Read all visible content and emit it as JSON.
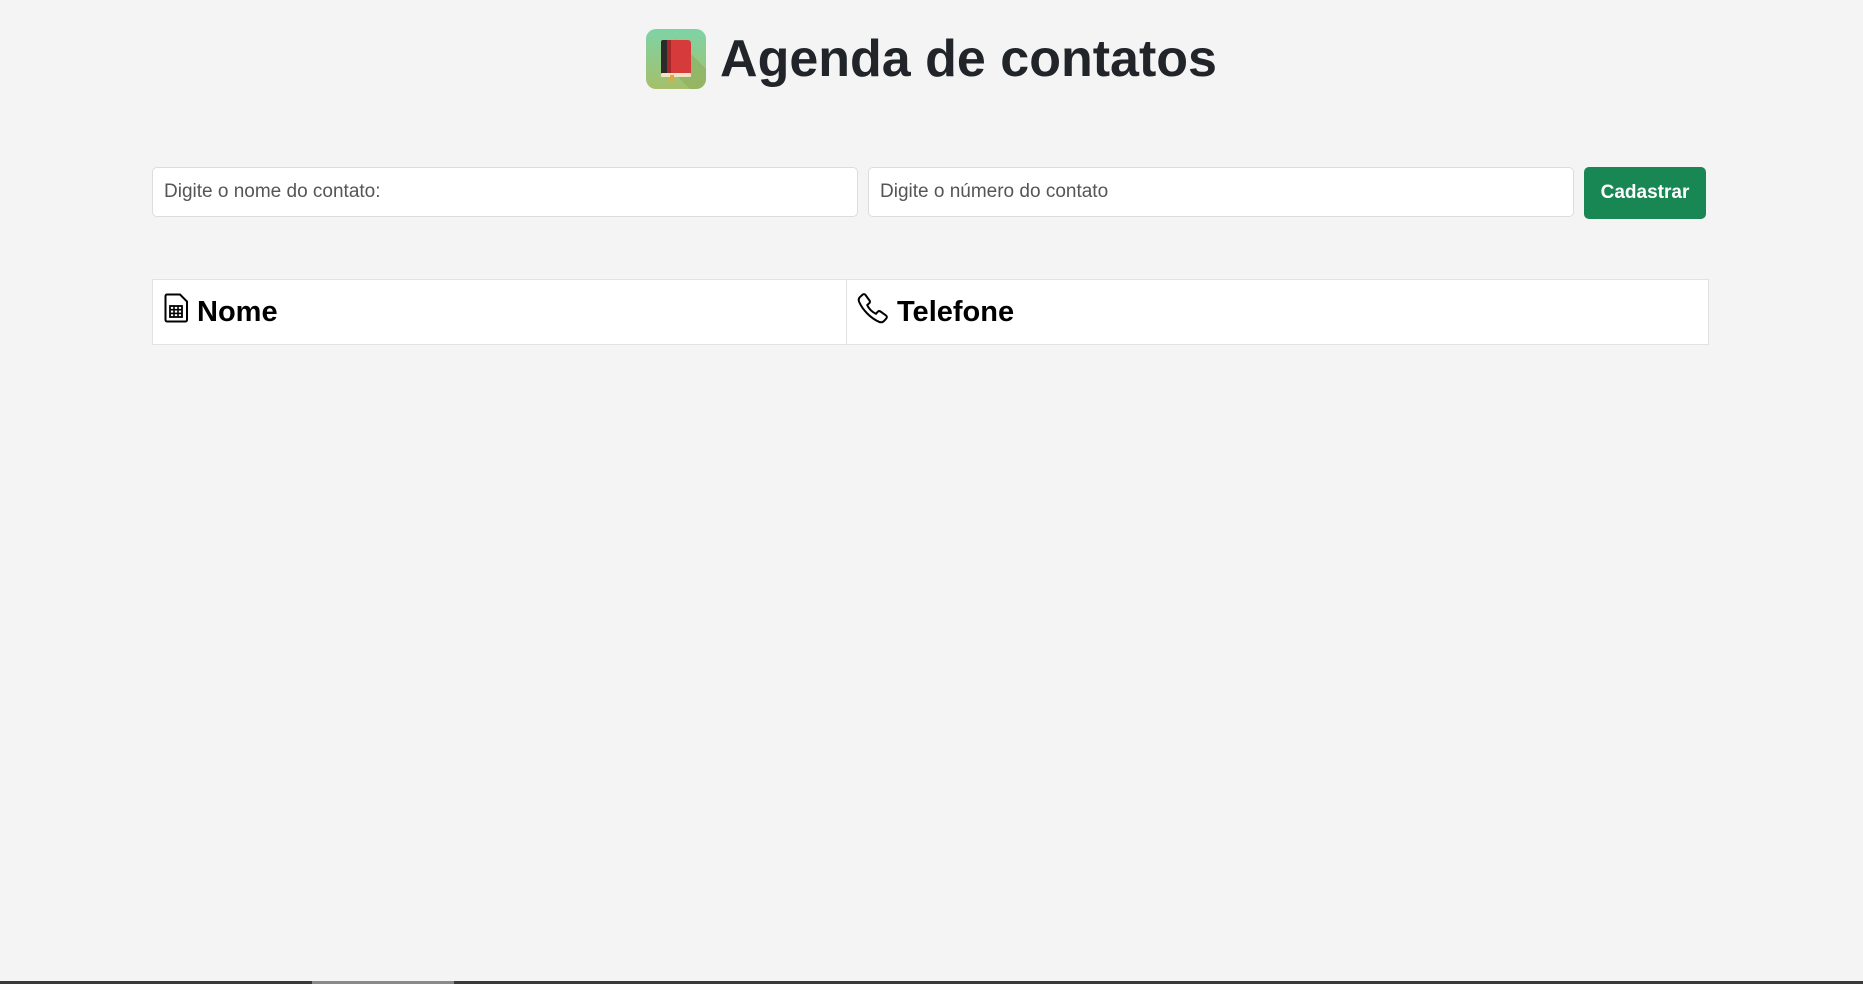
{
  "app": {
    "title": "Agenda de contatos",
    "icon": "address-book-icon"
  },
  "form": {
    "name_placeholder": "Digite o nome do contato:",
    "name_value": "",
    "number_placeholder": "Digite o número do contato",
    "number_value": "",
    "submit_label": "Cadastrar"
  },
  "table": {
    "columns": [
      {
        "label": "Nome",
        "icon": "sim-card-icon"
      },
      {
        "label": "Telefone",
        "icon": "telephone-icon"
      }
    ],
    "rows": []
  },
  "colors": {
    "background": "#f4f4f4",
    "primary_button": "#198754",
    "title_text": "#212529"
  }
}
